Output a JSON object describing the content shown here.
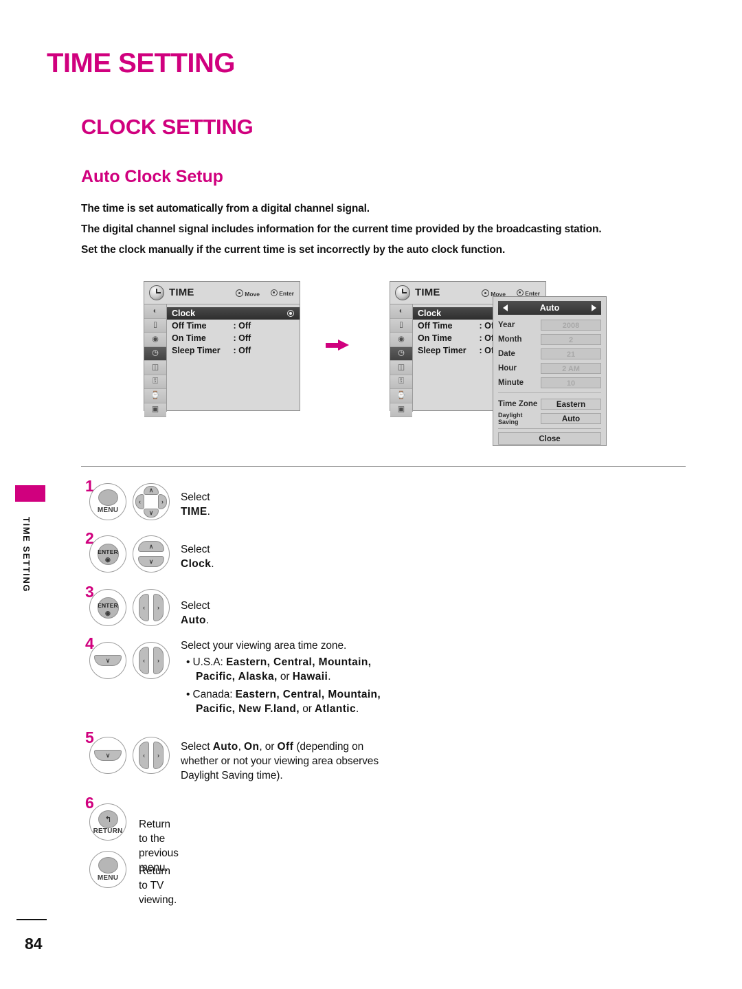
{
  "page": {
    "title": "TIME SETTING",
    "section_title": "CLOCK SETTING",
    "sub_title": "Auto Clock Setup",
    "side_tab_label": "TIME SETTING",
    "page_number": "84",
    "intro_lines": [
      "The time is set automatically from a digital channel signal.",
      "The digital channel signal includes information for the current time provided by the broadcasting station.",
      "Set the clock manually if the current time is set incorrectly by the auto clock function."
    ]
  },
  "osd": {
    "title": "TIME",
    "hint_move": "Move",
    "hint_enter": "Enter",
    "rail_icons": [
      "picture-icon",
      "screen-icon",
      "audio-icon",
      "time-icon",
      "option-icon",
      "lock-icon",
      "input-icon",
      "usb-icon"
    ],
    "rows": [
      {
        "label": "Clock",
        "value": "",
        "selected": true
      },
      {
        "label": "Off Time",
        "value": ": Off",
        "selected": false
      },
      {
        "label": "On Time",
        "value": ": Off",
        "selected": false
      },
      {
        "label": "Sleep Timer",
        "value": ": Off",
        "selected": false
      }
    ]
  },
  "auto_popup": {
    "header": "Auto",
    "fields": [
      {
        "label": "Year",
        "value": "2008"
      },
      {
        "label": "Month",
        "value": "2"
      },
      {
        "label": "Date",
        "value": "21"
      },
      {
        "label": "Hour",
        "value": "2 AM"
      },
      {
        "label": "Minute",
        "value": "10"
      }
    ],
    "time_zone_label": "Time Zone",
    "time_zone_value": "Eastern",
    "daylight_label_line1": "Daylight",
    "daylight_label_line2": "Saving",
    "daylight_value": "Auto",
    "close_label": "Close"
  },
  "buttons": {
    "menu": "MENU",
    "enter": "ENTER",
    "return": "RETURN",
    "up": "∧",
    "down": "∨",
    "left": "‹",
    "right": "›"
  },
  "steps": {
    "s1_num": "1",
    "s1_text_prefix": "Select ",
    "s1_text_bold": "TIME",
    "s1_text_suffix": ".",
    "s2_num": "2",
    "s2_text_prefix": "Select ",
    "s2_text_bold": "Clock",
    "s2_text_suffix": ".",
    "s3_num": "3",
    "s3_text_prefix": "Select ",
    "s3_text_bold": "Auto",
    "s3_text_suffix": ".",
    "s4_num": "4",
    "s4_line1": "Select your viewing area time zone.",
    "s4_usa_prefix": "• U.S.A: ",
    "s4_usa_zones": "Eastern, Central, Mountain,",
    "s4_usa_zones2": "Pacific, Alaska,",
    "s4_usa_or": " or ",
    "s4_usa_last": "Hawaii",
    "s4_usa_end": ".",
    "s4_canada_prefix": "• Canada: ",
    "s4_canada_zones": "Eastern, Central, Mountain,",
    "s4_canada_zones2": "Pacific, New F.land,",
    "s4_canada_or": " or ",
    "s4_canada_last": "Atlantic",
    "s4_canada_end": ".",
    "s5_num": "5",
    "s5_prefix": "Select ",
    "s5_opt1": "Auto",
    "s5_sep1": ", ",
    "s5_opt2": "On",
    "s5_sep2": ", or ",
    "s5_opt3": "Off",
    "s5_tail": " (depending on",
    "s5_line2": "whether or not your viewing area observes",
    "s5_line3": "Daylight Saving time).",
    "s6_num": "6",
    "s6_text": "Return to the previous menu.",
    "s7_text": "Return to TV viewing."
  }
}
